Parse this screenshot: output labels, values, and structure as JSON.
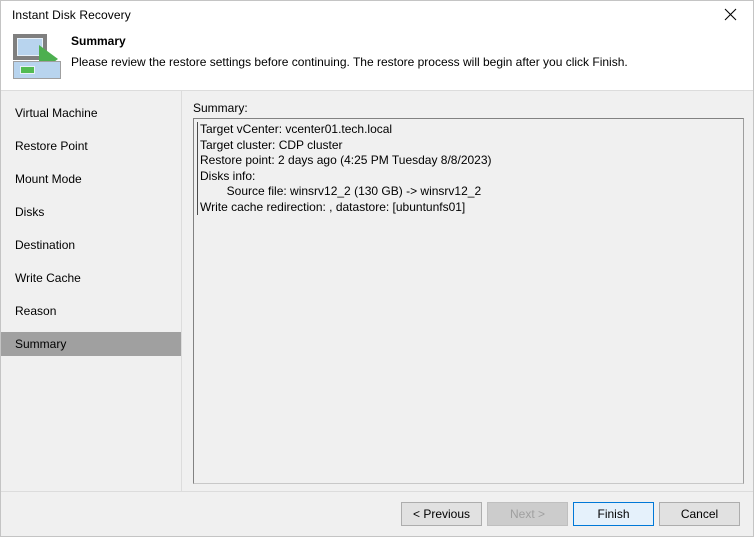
{
  "window": {
    "title": "Instant Disk Recovery",
    "close_icon": "close-icon"
  },
  "header": {
    "icon": "instant-disk-recovery-icon",
    "title": "Summary",
    "subtitle": "Please review the restore settings before continuing. The restore process will begin after you click Finish."
  },
  "sidebar": {
    "items": [
      {
        "label": "Virtual Machine",
        "selected": false
      },
      {
        "label": "Restore Point",
        "selected": false
      },
      {
        "label": "Mount Mode",
        "selected": false
      },
      {
        "label": "Disks",
        "selected": false
      },
      {
        "label": "Destination",
        "selected": false
      },
      {
        "label": "Write Cache",
        "selected": false
      },
      {
        "label": "Reason",
        "selected": false
      },
      {
        "label": "Summary",
        "selected": true
      }
    ],
    "selected_label": "Summary"
  },
  "main": {
    "label": "Summary:",
    "summary_lines": [
      "Target vCenter: vcenter01.tech.local",
      "Target cluster: CDP cluster",
      "Restore point: 2 days ago (4:25 PM Tuesday 8/8/2023)",
      "Disks info:",
      "        Source file: winsrv12_2 (130 GB) -> winsrv12_2",
      "Write cache redirection: , datastore: [ubuntunfs01]"
    ],
    "details": {
      "target_vcenter": "vcenter01.tech.local",
      "target_cluster": "CDP cluster",
      "restore_point": "2 days ago (4:25 PM Tuesday 8/8/2023)",
      "source_file": "winsrv12_2",
      "source_file_size": "130 GB",
      "target_disk": "winsrv12_2",
      "write_cache_redirection": "",
      "write_cache_datastore": "[ubuntunfs01]"
    }
  },
  "footer": {
    "previous_label": "< Previous",
    "next_label": "Next >",
    "finish_label": "Finish",
    "cancel_label": "Cancel"
  },
  "colors": {
    "accent": "#0078d7",
    "default_button_fill": "#e5f1fb",
    "selection": "#a0a0a0",
    "icon_green": "#4caf4f",
    "icon_blue": "#b8d4ee",
    "window_bg": "#f0f0f0"
  }
}
